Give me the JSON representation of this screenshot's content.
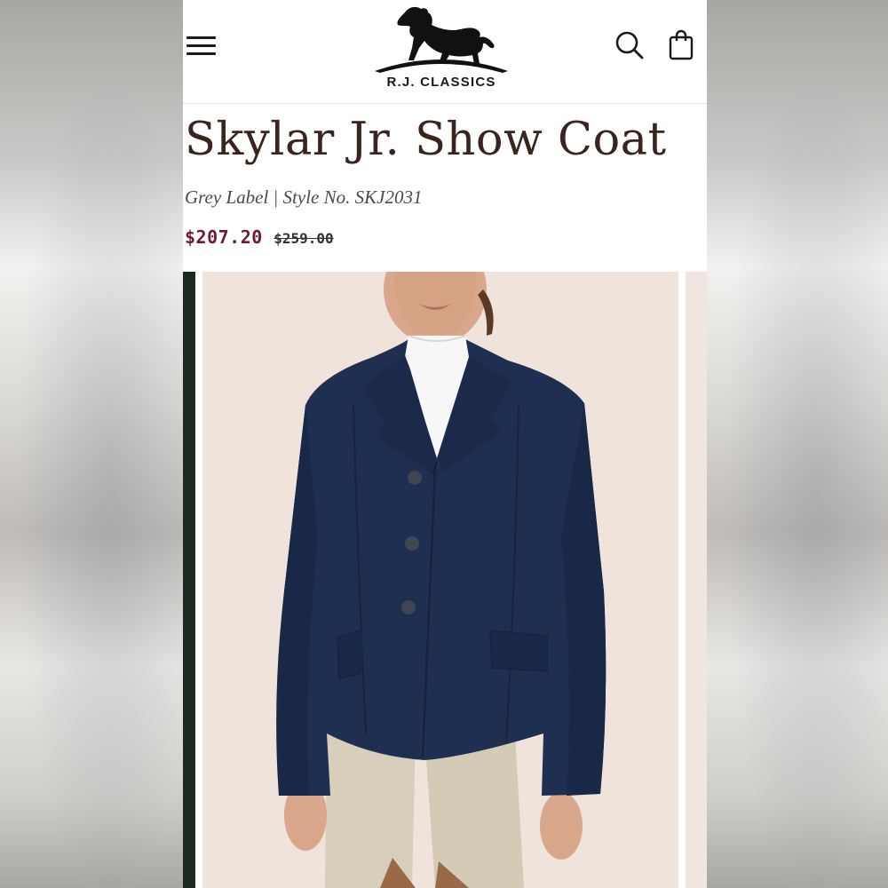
{
  "brand": {
    "name": "R.J. CLASSICS"
  },
  "header": {
    "menu_icon": "hamburger-menu-icon",
    "search_icon": "search-icon",
    "bag_icon": "shopping-bag-icon"
  },
  "product": {
    "title": "Skylar Jr. Show Coat",
    "meta": "Grey Label | Style No. SKJ2031",
    "sale_price": "$207.20",
    "original_price": "$259.00"
  },
  "gallery": {
    "main_image": "navy-show-coat-photo"
  },
  "colors": {
    "title": "#3a241d",
    "sale_price": "#6e1a38",
    "coat_navy": "#1f2f52",
    "photo_bg": "#efe3dc"
  }
}
